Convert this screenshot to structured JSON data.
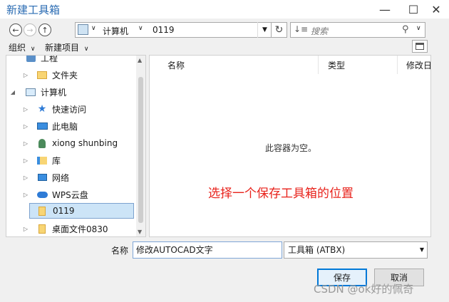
{
  "window": {
    "title": "新建工具箱",
    "minimize_glyph": "—",
    "maximize_glyph": "☐",
    "close_glyph": "✕"
  },
  "address_bar": {
    "breadcrumb": [
      "计算机",
      "0119"
    ],
    "search_placeholder": "搜索"
  },
  "toolbar": {
    "organize": "组织",
    "new_item": "新建项目"
  },
  "tree": {
    "items": [
      {
        "label": "工程",
        "icon": "project-icon",
        "indent": 1
      },
      {
        "label": "文件夹",
        "icon": "folder-icon",
        "indent": 1
      },
      {
        "label": "计算机",
        "icon": "computer-icon",
        "indent": 0
      },
      {
        "label": "快速访问",
        "icon": "quick-access-star-icon",
        "indent": 1
      },
      {
        "label": "此电脑",
        "icon": "this-pc-icon",
        "indent": 1
      },
      {
        "label": "xiong shunbing",
        "icon": "user-icon",
        "indent": 1
      },
      {
        "label": "库",
        "icon": "library-icon",
        "indent": 1
      },
      {
        "label": "网络",
        "icon": "network-icon",
        "indent": 1
      },
      {
        "label": "WPS云盘",
        "icon": "cloud-icon",
        "indent": 1
      },
      {
        "label": "0119",
        "icon": "folder-icon",
        "indent": 1
      },
      {
        "label": "桌面文件0830",
        "icon": "folder-icon",
        "indent": 1
      }
    ]
  },
  "content": {
    "columns": [
      "名称",
      "类型",
      "修改日"
    ],
    "empty_message": "此容器为空。",
    "annotation": "选择一个保存工具箱的位置",
    "annotation_color": "#e8221b"
  },
  "footer": {
    "name_label": "名称",
    "name_value": "修改AUTOCAD文字",
    "type_value": "工具箱 (ATBX)",
    "save_label": "保存",
    "cancel_label": "取消"
  },
  "watermark": "CSDN @ok好的佩奇",
  "colors": {
    "title": "#2b6cb3",
    "selection": "#cce4f7",
    "primary_border": "#0078d7"
  }
}
